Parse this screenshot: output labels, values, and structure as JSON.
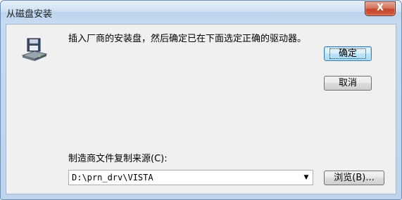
{
  "window": {
    "title": "从磁盘安装",
    "close_label": "X"
  },
  "message": "插入厂商的安装盘，然后确定已在下面选定正确的驱动器。",
  "buttons": {
    "ok_label": "确定",
    "cancel_label": "取消",
    "browse_label": "浏览(B)..."
  },
  "source": {
    "label": "制造商文件复制来源(C):",
    "value": "D:\\prn_drv\\VISTA"
  },
  "icons": {
    "disk": "floppy-disk-drive-icon",
    "dropdown": "chevron-down-icon"
  },
  "colors": {
    "close_button": "#c4432b",
    "default_button_border": "#3c7fb1",
    "client_bg": "#f0f0f0"
  }
}
